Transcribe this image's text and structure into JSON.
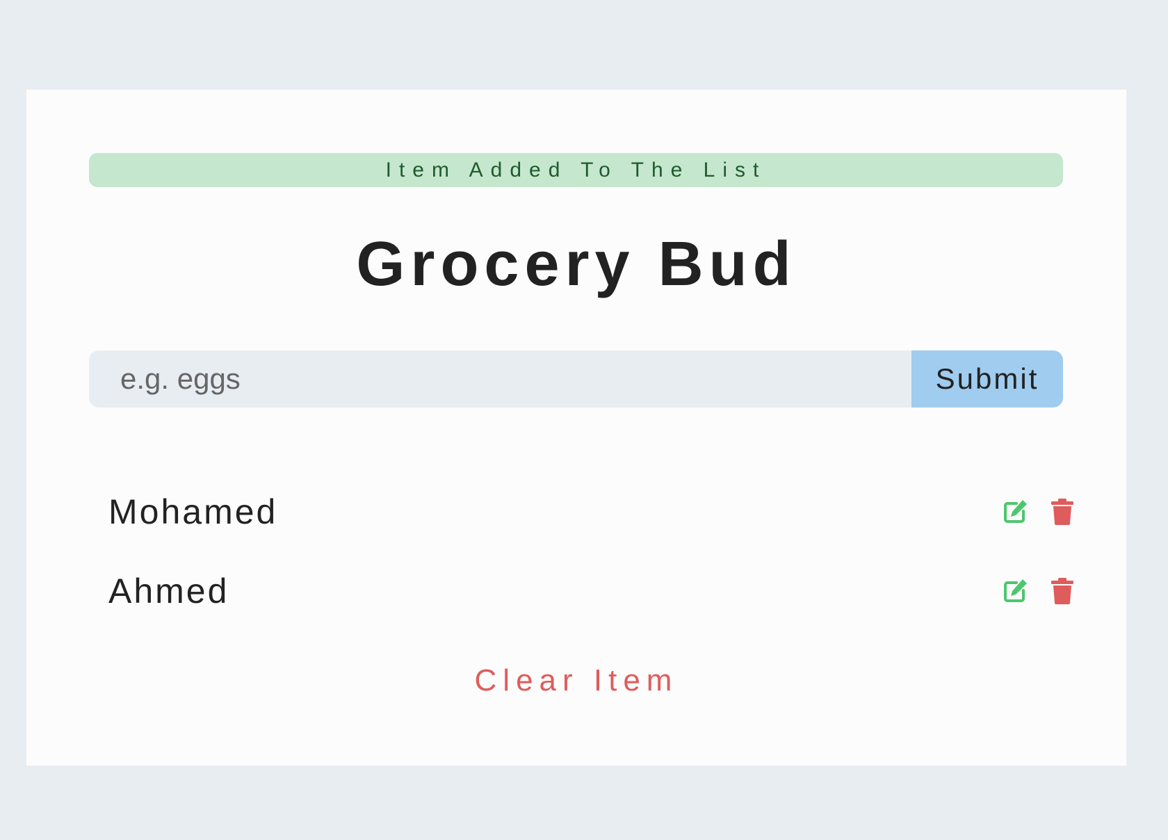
{
  "alert": {
    "text": "Item Added To The List"
  },
  "header": {
    "title": "Grocery Bud"
  },
  "form": {
    "placeholder": "e.g. eggs",
    "value": "",
    "submit_label": "Submit"
  },
  "items": [
    {
      "name": "Mohamed",
      "edit_icon": "edit-icon",
      "delete_icon": "trash-icon"
    },
    {
      "name": "Ahmed",
      "edit_icon": "edit-icon",
      "delete_icon": "trash-icon"
    }
  ],
  "footer": {
    "clear_label": "Clear Item"
  },
  "colors": {
    "background": "#e8edf2",
    "card": "#fcfcfc",
    "alert_bg": "#c5e7cd",
    "alert_text": "#1f5a2e",
    "submit_bg": "#9fccef",
    "edit": "#4cc76e",
    "delete": "#df5c5c",
    "clear": "#df5c5c"
  }
}
